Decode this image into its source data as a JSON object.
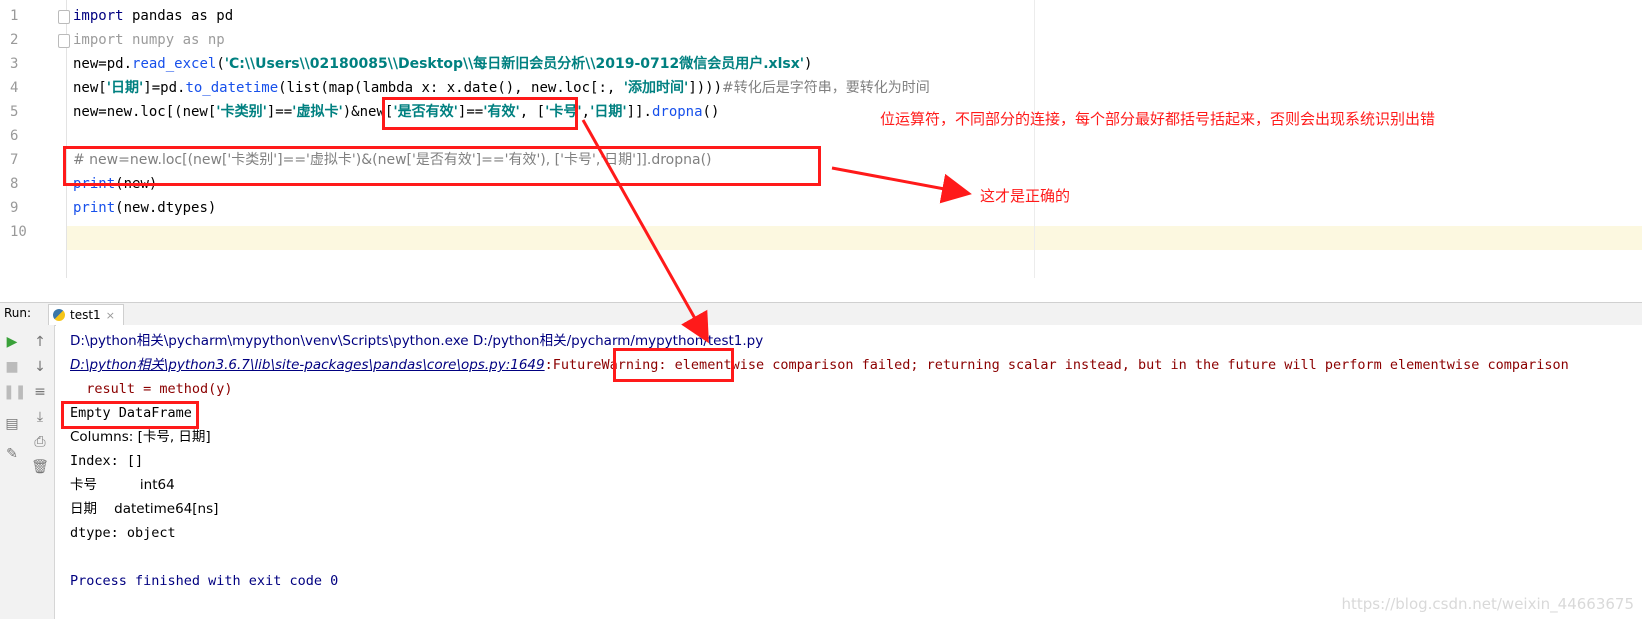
{
  "editor": {
    "line_numbers": [
      "1",
      "2",
      "3",
      "4",
      "5",
      "6",
      "7",
      "8",
      "9",
      "10"
    ],
    "lines": {
      "l1": {
        "kw": "import",
        "rest": " pandas as pd"
      },
      "l2": {
        "text": "import numpy as np"
      },
      "l3": {
        "a": "new=pd.",
        "fn": "read_excel",
        "b": "(",
        "str": "'C:\\\\Users\\\\02180085\\\\Desktop\\\\每日新旧会员分析\\\\2019-0712微信会员用户.xlsx'",
        "c": ")"
      },
      "l4": {
        "a": "new[",
        "s1": "'日期'",
        "b": "]=pd.",
        "fn": "to_datetime",
        "c": "(list(map(lambda x: x.date(), new.loc[:, ",
        "s2": "'添加时间'",
        "d": "])))",
        "cm": "#转化后是字符串，要转化为时间"
      },
      "l5": {
        "a": "new=new.loc[(new[",
        "s1": "'卡类别'",
        "b": "]==",
        "s2": "'虚拟卡'",
        "c": ")&new[",
        "s3": "'是否有效'",
        "d": "]==",
        "s4": "'有效'",
        "e": ", [",
        "s5": "'卡号'",
        "f": ",",
        "s6": "'日期'",
        "g": "]].",
        "fn": "dropna",
        "h": "()"
      },
      "l7": {
        "cm": "# new=new.loc[(new['卡类别']=='虚拟卡')&(new['是否有效']=='有效'), ['卡号','日期']].dropna()"
      },
      "l8": {
        "fn": "print",
        "rest": "(new)"
      },
      "l9": {
        "fn": "print",
        "rest": "(new.dtypes)"
      }
    }
  },
  "run_panel": {
    "label": "Run:",
    "tab_label": "test1",
    "close_glyph": "×"
  },
  "console": {
    "cmd": "D:\\python相关\\pycharm\\mypython\\venv\\Scripts\\python.exe D:/python相关/pycharm/mypython/test1.py",
    "warn_path": "D:\\python相关\\python3.6.7\\lib\\site-packages\\pandas\\core\\ops.py:1649",
    "warn_colon": ":",
    "warn_type": "FutureWarning",
    "warn_msg": ": elementwise comparison failed; returning scalar instead, but in the future will perform elementwise comparison",
    "result_line": "  result = method(y)",
    "empty_df": "Empty DataFrame",
    "columns": "Columns: [卡号, 日期]",
    "index": "Index: []",
    "dtype_row1": "卡号          int64",
    "dtype_row2": "日期    datetime64[ns]",
    "dtype_footer": "dtype: object",
    "finished": "Process finished with exit code 0"
  },
  "annotations": {
    "note_operator": "位运算符，不同部分的连接，每个部分最好都括号括起来，否则会出现系统识别出错",
    "note_correct": "这才是正确的",
    "watermark": "https://blog.csdn.net/weixin_44663675",
    "color": "#ff1a1a"
  }
}
